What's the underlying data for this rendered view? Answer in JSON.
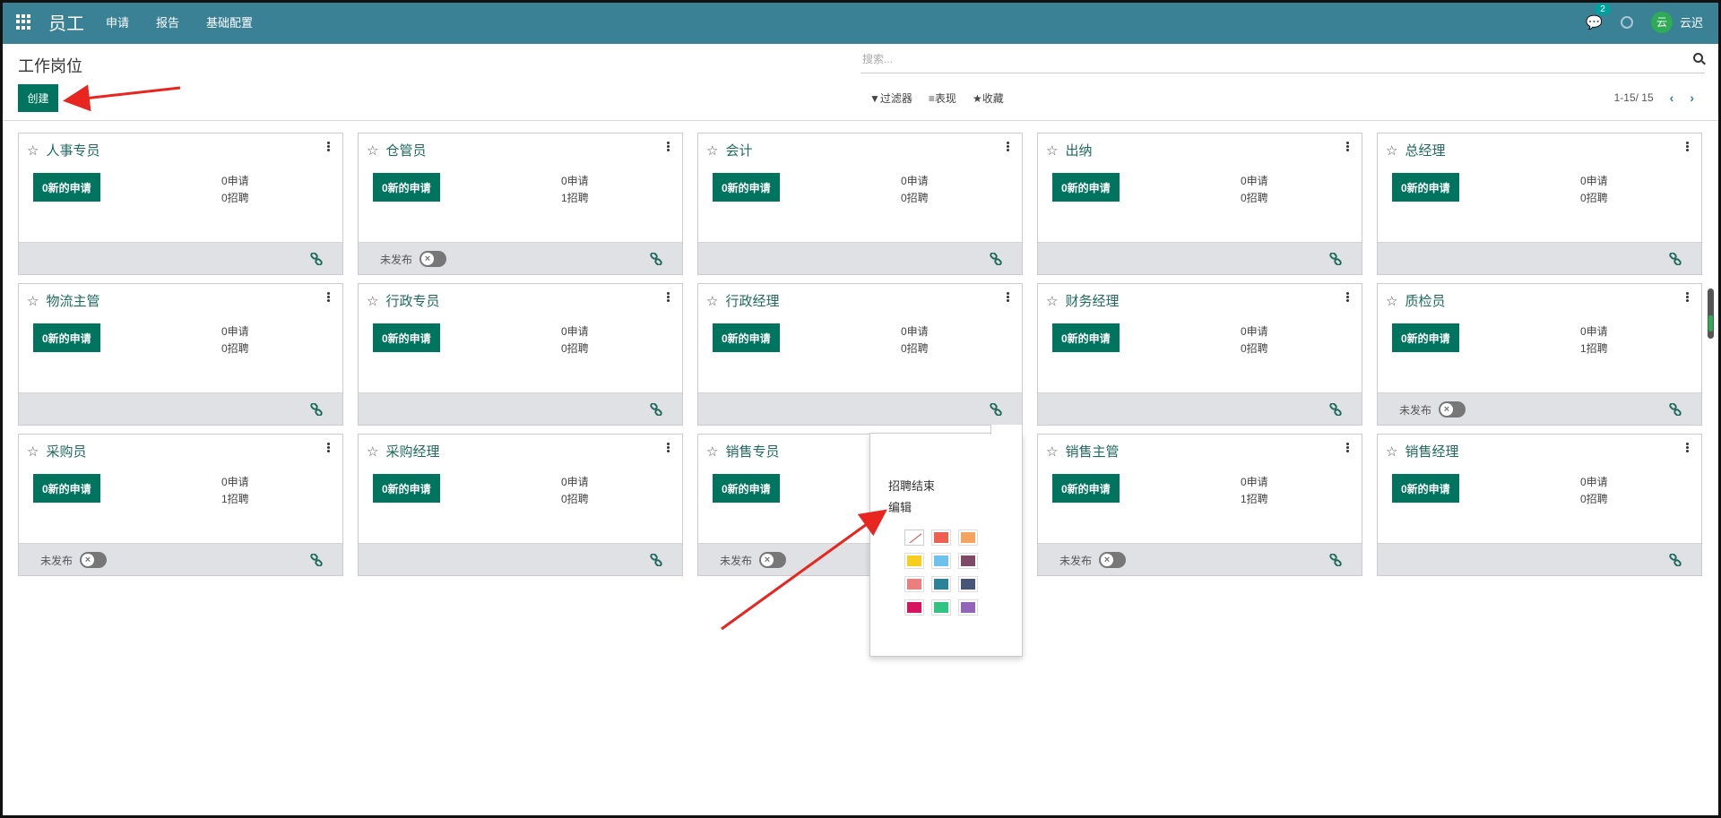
{
  "navbar": {
    "app_name": "员工",
    "menu": [
      "申请",
      "报告",
      "基础配置"
    ],
    "chat_count": "2",
    "user_initial": "云",
    "user_name": "云迟"
  },
  "control_panel": {
    "title": "工作岗位",
    "create_label": "创建",
    "search_placeholder": "搜索...",
    "filter_label": "过滤器",
    "group_label": "表现",
    "favorites_label": "收藏",
    "pager": "1-15/ 15"
  },
  "colors": {
    "navbar": "#3b8196",
    "primary": "#00745f",
    "title_text": "#1f6b5e",
    "footer": "#e0e1e4"
  },
  "cards": [
    {
      "title": "人事专员",
      "new_label": "0新的申请",
      "applications": "0申请",
      "hires": "0招聘",
      "unpublished": ""
    },
    {
      "title": "仓管员",
      "new_label": "0新的申请",
      "applications": "0申请",
      "hires": "1招聘",
      "unpublished": "未发布"
    },
    {
      "title": "会计",
      "new_label": "0新的申请",
      "applications": "0申请",
      "hires": "0招聘",
      "unpublished": ""
    },
    {
      "title": "出纳",
      "new_label": "0新的申请",
      "applications": "0申请",
      "hires": "0招聘",
      "unpublished": ""
    },
    {
      "title": "总经理",
      "new_label": "0新的申请",
      "applications": "0申请",
      "hires": "0招聘",
      "unpublished": ""
    },
    {
      "title": "物流主管",
      "new_label": "0新的申请",
      "applications": "0申请",
      "hires": "0招聘",
      "unpublished": ""
    },
    {
      "title": "行政专员",
      "new_label": "0新的申请",
      "applications": "0申请",
      "hires": "0招聘",
      "unpublished": ""
    },
    {
      "title": "行政经理",
      "new_label": "0新的申请",
      "applications": "0申请",
      "hires": "0招聘",
      "unpublished": ""
    },
    {
      "title": "财务经理",
      "new_label": "0新的申请",
      "applications": "0申请",
      "hires": "0招聘",
      "unpublished": ""
    },
    {
      "title": "质检员",
      "new_label": "0新的申请",
      "applications": "0申请",
      "hires": "1招聘",
      "unpublished": "未发布"
    },
    {
      "title": "采购员",
      "new_label": "0新的申请",
      "applications": "0申请",
      "hires": "1招聘",
      "unpublished": "未发布"
    },
    {
      "title": "采购经理",
      "new_label": "0新的申请",
      "applications": "0申请",
      "hires": "0招聘",
      "unpublished": ""
    },
    {
      "title": "销售专员",
      "new_label": "0新的申请",
      "applications": "",
      "hires": "",
      "unpublished": "未发布"
    },
    {
      "title": "销售主管",
      "new_label": "0新的申请",
      "applications": "0申请",
      "hires": "1招聘",
      "unpublished": "未发布"
    },
    {
      "title": "销售经理",
      "new_label": "0新的申请",
      "applications": "0申请",
      "hires": "0招聘",
      "unpublished": ""
    }
  ],
  "dropdown": {
    "items": [
      "招聘结束",
      "编辑"
    ],
    "swatches": [
      "none",
      "#f06050",
      "#f4a460",
      "#f7cd1f",
      "#6cc1ed",
      "#814968",
      "#eb7e7f",
      "#2c8397",
      "#475577",
      "#d6145f",
      "#30c381",
      "#9365b8"
    ]
  }
}
